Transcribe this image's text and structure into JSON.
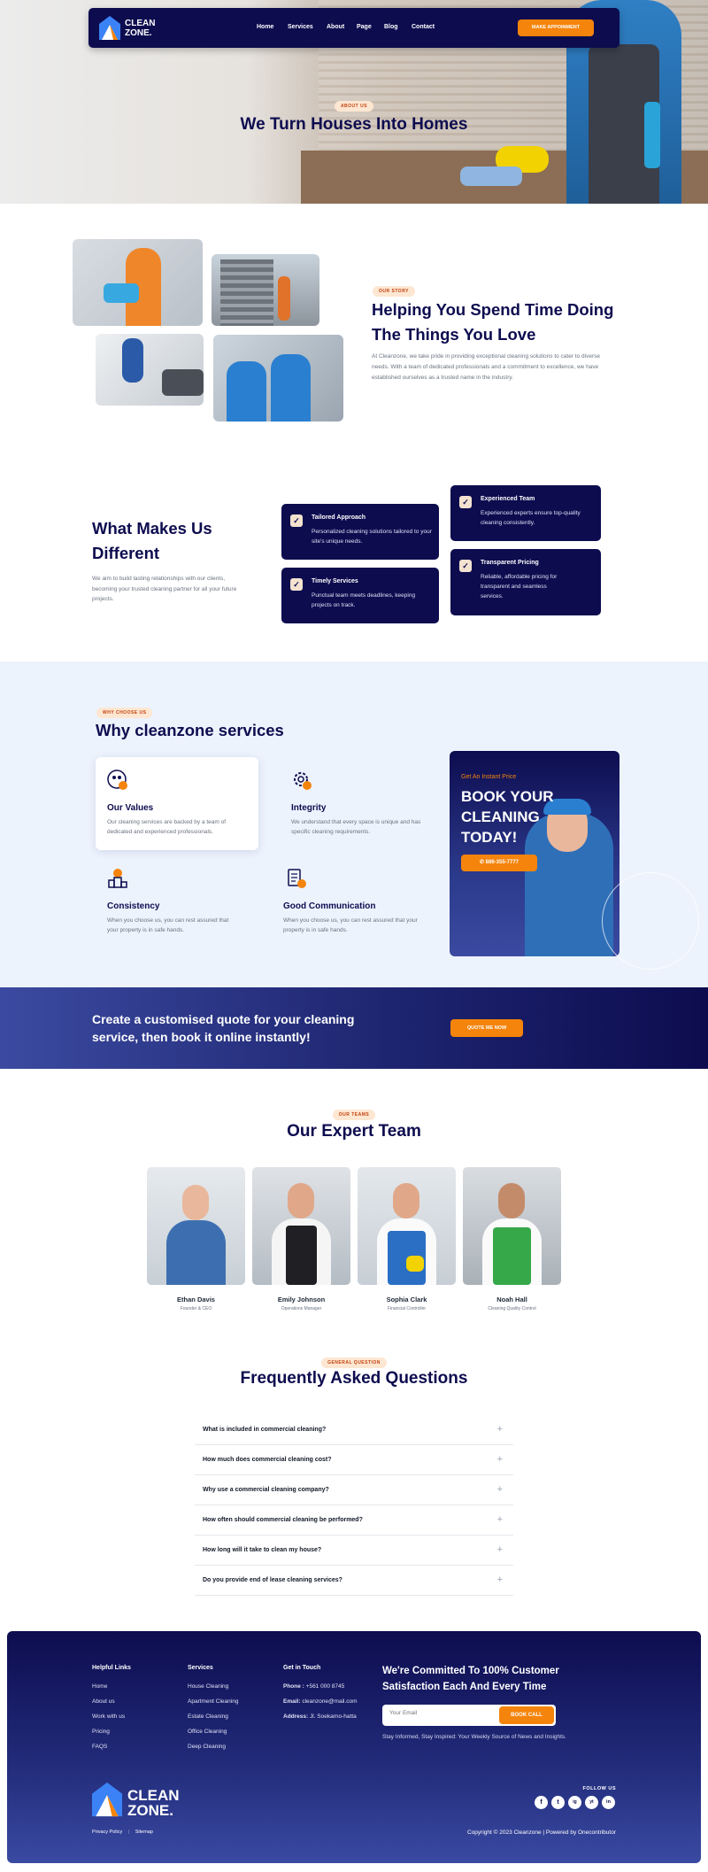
{
  "brand": {
    "line1": "CLEAN",
    "line2": "ZONE."
  },
  "nav": {
    "items": [
      "Home",
      "Services",
      "About",
      "Page",
      "Blog",
      "Contact"
    ],
    "cta": "MAKE APPOINMENT"
  },
  "hero": {
    "badge": "ABOUT US",
    "title": "We Turn Houses Into Homes"
  },
  "story": {
    "badge": "OUR STORY",
    "title_line1": "Helping You Spend Time Doing",
    "title_line2": "The Things You Love",
    "text": "At Cleanzone, we take pride in providing exceptional cleaning solutions to cater to diverse needs. With a team of dedicated professionals and a commitment to excellence, we have established ourselves as a trusted name in the industry."
  },
  "different": {
    "title_line1": "What Makes Us",
    "title_line2": "Different",
    "text": "We aim to build lasting relationships with our clients, becoming your trusted cleaning partner for all your future projects.",
    "features": [
      {
        "title": "Tailored Approach",
        "desc": "Personalized cleaning solutions tailored to your site's unique needs."
      },
      {
        "title": "Timely Services",
        "desc": "Punctual team meets deadlines, keeping projects on track."
      },
      {
        "title": "Experienced Team",
        "desc": "Experienced experts ensure top-quality cleaning consistently."
      },
      {
        "title": "Transparent Pricing",
        "desc": "Reliable, affordable pricing for transparent and seamless services."
      }
    ]
  },
  "why": {
    "badge": "WHY CHOOSE US",
    "title": "Why cleanzone services",
    "items": [
      {
        "title": "Our Values",
        "desc": "Our cleaning services are backed by a team of dedicated and experienced professionals."
      },
      {
        "title": "Integrity",
        "desc": "We understand that every space is unique and has specific cleaning requirements."
      },
      {
        "title": "Consistency",
        "desc": "When you choose us, you can rest assured that your property is in safe hands."
      },
      {
        "title": "Good Communication",
        "desc": "When you choose us, you can rest assured that your property is in safe hands."
      }
    ],
    "promo": {
      "kicker": "Get An Instant Price",
      "line1": "BOOK YOUR",
      "line2": "CLEANING",
      "line3": "TODAY!",
      "phone": "886-355-7777"
    }
  },
  "quote": {
    "line1": "Create a customised quote for your cleaning",
    "line2": "service, then book it online instantly!",
    "button": "QUOTE ME NOW"
  },
  "team": {
    "badge": "OUR TEAMS",
    "title": "Our Expert Team",
    "members": [
      {
        "name": "Ethan Davis",
        "role": "Founder & CEO"
      },
      {
        "name": "Emily Johnson",
        "role": "Operations Manager"
      },
      {
        "name": "Sophia Clark",
        "role": "Financial Controller"
      },
      {
        "name": "Noah Hall",
        "role": "Cleaning Quality Control"
      }
    ]
  },
  "faq": {
    "badge": "GENERAL QUESTION",
    "title": "Frequently Asked Questions",
    "questions": [
      "What is included in commercial cleaning?",
      "How much does commercial cleaning cost?",
      "Why use a commercial cleaning company?",
      "How often should commercial cleaning be performed?",
      "How long will it take to clean my house?",
      "Do you provide end of lease cleaning services?"
    ]
  },
  "footer": {
    "col1": {
      "title": "Helpful Links",
      "links": [
        "Home",
        "About us",
        "Work with us",
        "Pricing",
        "FAQS"
      ]
    },
    "col2": {
      "title": "Services",
      "links": [
        "House Cleaning",
        "Apartment Cleaning",
        "Estate Cleaning",
        "Office Cleaning",
        "Deep Cleaning"
      ]
    },
    "col3": {
      "title": "Get in Touch",
      "phone_label": "Phone :",
      "phone": "+561 000 8745",
      "email_label": "Email:",
      "email": "cleanzone@mail.com",
      "address_label": "Address:",
      "address": "Jl. Soekarno-hatta"
    },
    "cta": {
      "line1": "We're Committed To 100% Customer",
      "line2": "Satisfaction Each And Every Time",
      "placeholder": "Your Email",
      "button": "BOOK CALL",
      "note": "Stay Informed, Stay Inspired: Your Weekly Source of News and Insights."
    },
    "follow": "FOLLOW US",
    "social": [
      "f",
      "t",
      "ig",
      "yt",
      "in"
    ],
    "legal": [
      "Privacy Policy",
      "Sitemap"
    ],
    "copyright": "Copyright © 2023 Cleanzone | Powered by Onecontributor"
  },
  "colors": {
    "navy": "#0d0c4f",
    "orange": "#f5840c",
    "light_blue": "#edf3fd"
  }
}
